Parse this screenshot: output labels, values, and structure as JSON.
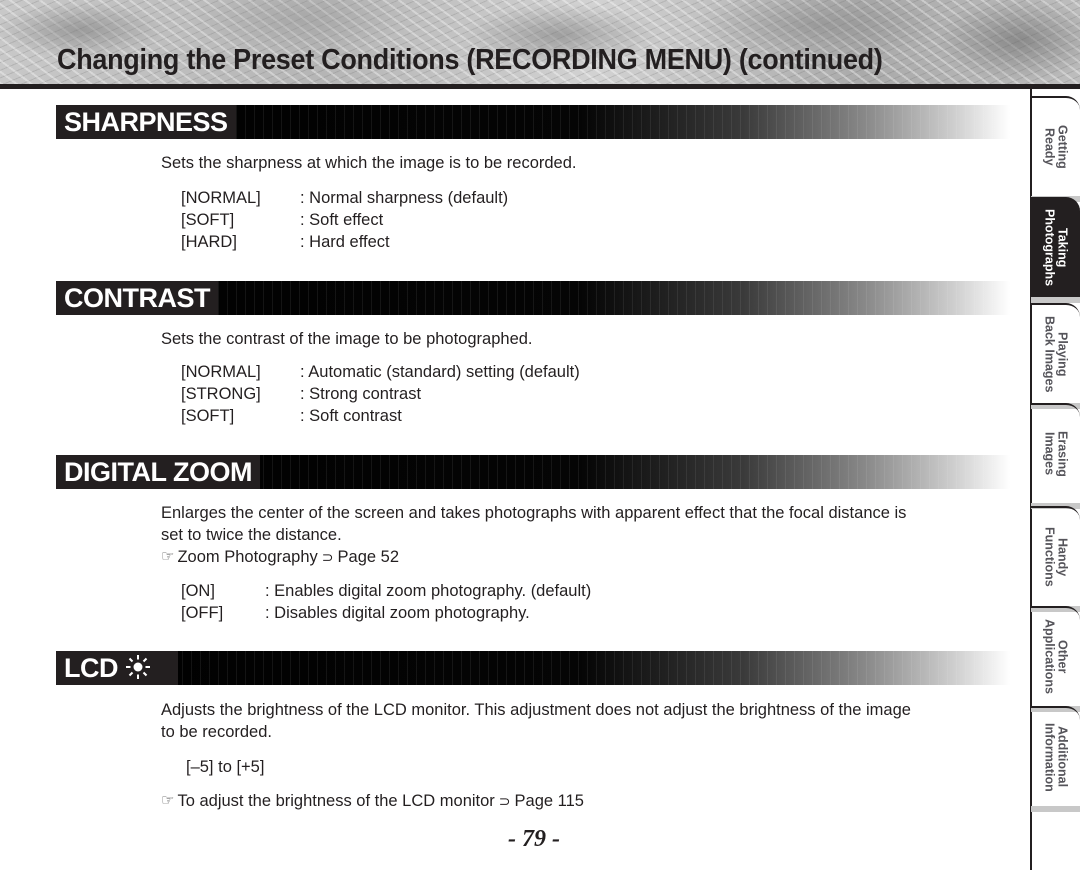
{
  "header": {
    "title": "Changing the Preset Conditions (RECORDING MENU) (continued)"
  },
  "side_tabs": [
    {
      "label": "Getting\nReady",
      "active": false
    },
    {
      "label": "Taking\nPhotographs",
      "active": true
    },
    {
      "label": "Playing\nBack Images",
      "active": false
    },
    {
      "label": "Erasing\nImages",
      "active": false
    },
    {
      "label": "Handy\nFunctions",
      "active": false
    },
    {
      "label": "Other\nApplications",
      "active": false
    },
    {
      "label": "Additional\nInformation",
      "active": false
    }
  ],
  "sections": {
    "sharpness": {
      "heading": "SHARPNESS",
      "description": "Sets the sharpness at which the image is to be recorded.",
      "options": [
        {
          "key": "[NORMAL]",
          "value": ": Normal sharpness (default)"
        },
        {
          "key": "[SOFT]",
          "value": ": Soft effect"
        },
        {
          "key": "[HARD]",
          "value": ": Hard effect"
        }
      ]
    },
    "contrast": {
      "heading": "CONTRAST",
      "description": "Sets the contrast of the image to be photographed.",
      "options": [
        {
          "key": "[NORMAL]",
          "value": ": Automatic (standard) setting (default)"
        },
        {
          "key": "[STRONG]",
          "value": ": Strong contrast"
        },
        {
          "key": "[SOFT]",
          "value": ": Soft contrast"
        }
      ]
    },
    "digital_zoom": {
      "heading": "DIGITAL ZOOM",
      "description_line1": "Enlarges the center of the screen and takes photographs with apparent effect that the focal distance is",
      "description_line2": "set to twice the distance.",
      "reference": {
        "icon": "pointing-hand-icon",
        "text": "Zoom Photography",
        "arrow": "page-arrow-icon",
        "page": "Page 52"
      },
      "options": [
        {
          "key": "[ON]",
          "value": ": Enables digital zoom photography. (default)"
        },
        {
          "key": "[OFF]",
          "value": ": Disables digital zoom photography."
        }
      ]
    },
    "lcd": {
      "heading": "LCD",
      "heading_icon": "brightness-sun-icon",
      "description_line1": "Adjusts the brightness of the LCD monitor. This adjustment does not adjust the brightness of the image",
      "description_line2": "to be recorded.",
      "range": "[–5] to [+5]",
      "reference": {
        "icon": "pointing-hand-icon",
        "text": "To adjust the brightness of the LCD monitor",
        "arrow": "page-arrow-icon",
        "page": "Page 115"
      }
    }
  },
  "footer": {
    "page_number": "- 79 -"
  },
  "icons": {
    "hand": "☞",
    "arrow": "⊃"
  }
}
